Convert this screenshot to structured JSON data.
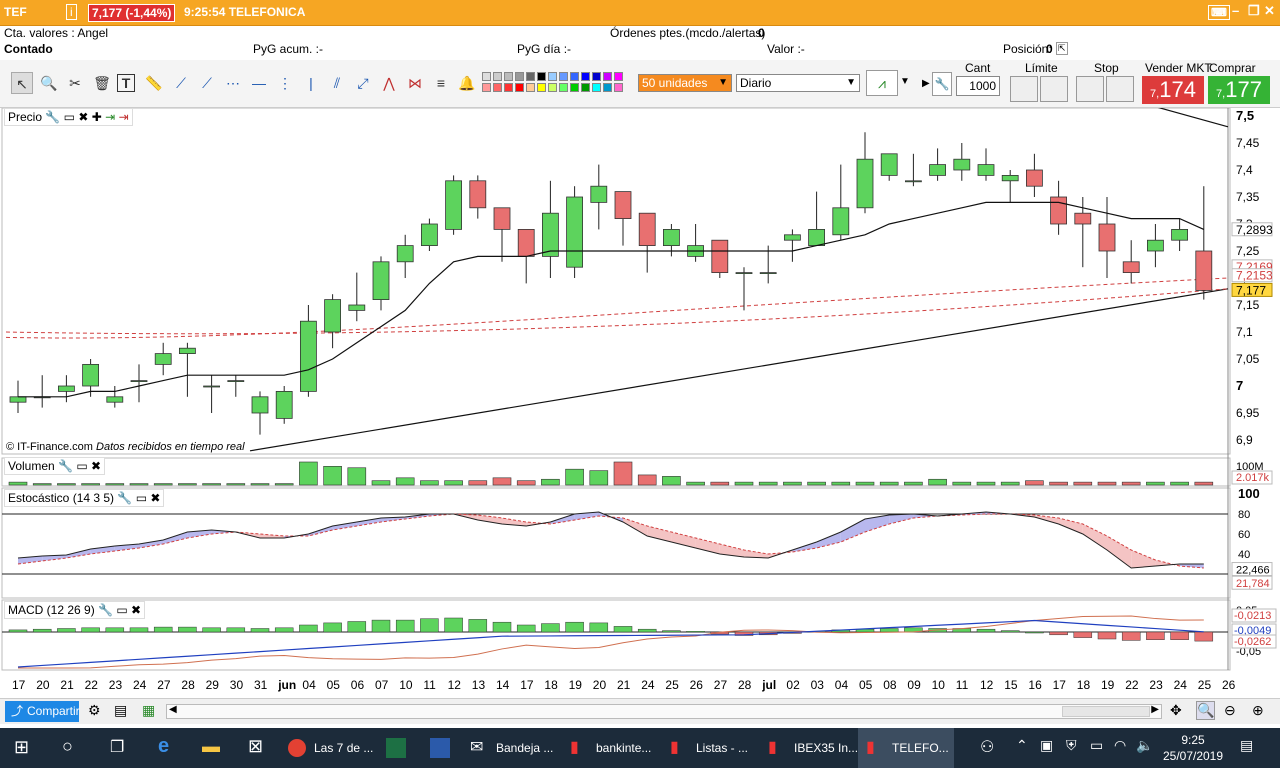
{
  "titlebar": {
    "symbol": "TEF",
    "price_change": "7,177 (-1,44%)",
    "time_name": "9:25:54 TELEFONICA"
  },
  "info": {
    "account": "Cta. valores : Angel",
    "pending_label": "Órdenes ptes.(mcdo./alertas)",
    "pending_value": "0",
    "mode": "Contado",
    "pyg_acum": "PyG acum. :-",
    "pyg_dia": "PyG día :-",
    "valor": "Valor :-",
    "posicion_label": "Posición:",
    "posicion_value": "0"
  },
  "toolbar": {
    "units": "50 unidades",
    "period": "Diario",
    "cant_label": "Cant",
    "qty": "1000",
    "limit_label": "Límite",
    "stop_label": "Stop",
    "sell_label": "Vender MKT",
    "sell_price": "7,174",
    "sell_prefix": "7,",
    "sell_main": "174",
    "buy_label": "Comprar MKT",
    "buy_prefix": "7,",
    "buy_main": "177"
  },
  "panels": {
    "price": "Precio",
    "volume": "Volumen",
    "stoch": "Estocástico (14 3 5)",
    "macd": "MACD (12 26 9)",
    "credit": "© IT-Finance.com",
    "credit2": "Datos recibidos en tiempo real"
  },
  "price_axis": [
    "7,5",
    "7,45",
    "7,4",
    "7,35",
    "7,3",
    "7,25",
    "7,2",
    "7,15",
    "7,1",
    "7,05",
    "7",
    "6,95",
    "6,9"
  ],
  "price_tags": [
    "7,2893",
    "7,2169",
    "7,2153",
    "7,177"
  ],
  "vol_axis": [
    "100M",
    "2.017k"
  ],
  "stoch_axis": [
    "100",
    "80",
    "60",
    "40"
  ],
  "stoch_tags": [
    "22,466",
    "21,784"
  ],
  "macd_axis": [
    "0,05",
    "-0,05"
  ],
  "macd_tags": [
    "-0,0213",
    "-0,0049",
    "-0,0262"
  ],
  "dates": [
    "17",
    "20",
    "21",
    "22",
    "23",
    "24",
    "27",
    "28",
    "29",
    "30",
    "31",
    "jun",
    "04",
    "05",
    "06",
    "07",
    "10",
    "11",
    "12",
    "13",
    "14",
    "17",
    "18",
    "19",
    "20",
    "21",
    "24",
    "25",
    "26",
    "27",
    "28",
    "jul",
    "02",
    "03",
    "04",
    "05",
    "08",
    "09",
    "10",
    "11",
    "12",
    "15",
    "16",
    "17",
    "18",
    "19",
    "22",
    "23",
    "24",
    "25",
    "26"
  ],
  "chart_data": {
    "type": "candlestick",
    "x": [
      "17",
      "20",
      "21",
      "22",
      "23",
      "24",
      "27",
      "28",
      "29",
      "30",
      "31",
      "jun",
      "04",
      "05",
      "06",
      "07",
      "10",
      "11",
      "12",
      "13",
      "14",
      "17",
      "18",
      "19",
      "20",
      "21",
      "24",
      "25",
      "26",
      "27",
      "28",
      "jul",
      "02",
      "03",
      "04",
      "05",
      "08",
      "09",
      "10",
      "11",
      "12",
      "15",
      "16",
      "17",
      "18",
      "19",
      "22",
      "23",
      "24",
      "25"
    ],
    "open": [
      6.97,
      6.98,
      6.99,
      7.0,
      6.97,
      7.01,
      7.04,
      7.06,
      7.0,
      7.01,
      6.95,
      6.94,
      6.99,
      7.1,
      7.14,
      7.16,
      7.23,
      7.26,
      7.29,
      7.38,
      7.33,
      7.29,
      7.24,
      7.22,
      7.34,
      7.36,
      7.32,
      7.26,
      7.24,
      7.27,
      7.21,
      7.21,
      7.27,
      7.26,
      7.28,
      7.33,
      7.39,
      7.38,
      7.39,
      7.4,
      7.39,
      7.38,
      7.4,
      7.35,
      7.32,
      7.3,
      7.23,
      7.25,
      7.27,
      7.25
    ],
    "close": [
      6.98,
      6.98,
      7.0,
      7.04,
      6.98,
      7.01,
      7.06,
      7.07,
      7.0,
      7.01,
      6.98,
      6.99,
      7.12,
      7.16,
      7.15,
      7.23,
      7.26,
      7.3,
      7.38,
      7.33,
      7.29,
      7.24,
      7.32,
      7.35,
      7.37,
      7.31,
      7.26,
      7.29,
      7.26,
      7.21,
      7.21,
      7.21,
      7.28,
      7.29,
      7.33,
      7.42,
      7.43,
      7.38,
      7.41,
      7.42,
      7.41,
      7.39,
      7.37,
      7.3,
      7.3,
      7.25,
      7.21,
      7.27,
      7.29,
      7.177
    ],
    "high": [
      7.01,
      7.02,
      7.02,
      7.05,
      7.0,
      7.04,
      7.08,
      7.08,
      7.02,
      7.02,
      6.99,
      7.0,
      7.15,
      7.17,
      7.21,
      7.24,
      7.28,
      7.31,
      7.39,
      7.39,
      7.32,
      7.26,
      7.38,
      7.37,
      7.41,
      7.36,
      7.32,
      7.3,
      7.3,
      7.27,
      7.22,
      7.26,
      7.29,
      7.36,
      7.41,
      7.47,
      7.43,
      7.43,
      7.44,
      7.45,
      7.44,
      7.4,
      7.43,
      7.38,
      7.35,
      7.35,
      7.27,
      7.3,
      7.31,
      7.37
    ],
    "low": [
      6.95,
      6.96,
      6.97,
      6.98,
      6.96,
      6.97,
      7.02,
      6.98,
      6.95,
      6.98,
      6.91,
      6.93,
      6.98,
      7.07,
      7.12,
      7.14,
      7.2,
      7.25,
      7.28,
      7.31,
      7.23,
      7.19,
      7.2,
      7.2,
      7.29,
      7.26,
      7.21,
      7.24,
      7.23,
      7.2,
      7.14,
      7.19,
      7.23,
      7.26,
      7.27,
      7.32,
      7.38,
      7.37,
      7.38,
      7.38,
      7.38,
      7.34,
      7.35,
      7.28,
      7.22,
      7.2,
      7.19,
      7.22,
      7.25,
      7.16
    ],
    "volume": [
      2,
      1,
      1,
      1,
      1,
      1,
      1,
      1,
      1,
      1,
      1,
      1,
      16,
      13,
      12,
      3,
      5,
      3,
      3,
      3,
      5,
      3,
      4,
      11,
      10,
      16,
      7,
      6,
      2,
      2,
      2,
      2,
      2,
      2,
      2,
      2,
      2,
      2,
      4,
      2,
      2,
      2,
      3,
      2,
      2,
      2,
      2,
      2,
      2,
      2
    ],
    "ma": [
      6.98,
      6.98,
      6.98,
      6.99,
      6.99,
      7.0,
      7.01,
      7.02,
      7.02,
      7.02,
      7.02,
      7.02,
      7.03,
      7.05,
      7.08,
      7.11,
      7.14,
      7.19,
      7.23,
      7.24,
      7.24,
      7.24,
      7.25,
      7.25,
      7.25,
      7.25,
      7.25,
      7.25,
      7.25,
      7.25,
      7.25,
      7.25,
      7.25,
      7.26,
      7.27,
      7.28,
      7.3,
      7.31,
      7.32,
      7.33,
      7.34,
      7.34,
      7.34,
      7.34,
      7.33,
      7.32,
      7.31,
      7.31,
      7.31,
      7.29
    ],
    "stoch_k": [
      36,
      38,
      39,
      45,
      48,
      50,
      54,
      62,
      64,
      62,
      56,
      56,
      60,
      68,
      72,
      76,
      77,
      80,
      80,
      74,
      70,
      68,
      72,
      80,
      82,
      72,
      58,
      52,
      46,
      40,
      37,
      36,
      44,
      52,
      62,
      75,
      79,
      80,
      78,
      80,
      82,
      80,
      77,
      70,
      60,
      44,
      26,
      28,
      30,
      30
    ],
    "stoch_d": [
      30,
      33,
      36,
      40,
      43,
      46,
      50,
      56,
      60,
      62,
      60,
      58,
      58,
      64,
      68,
      72,
      75,
      78,
      80,
      79,
      76,
      72,
      70,
      74,
      78,
      76,
      68,
      62,
      56,
      50,
      44,
      40,
      42,
      46,
      52,
      62,
      70,
      76,
      78,
      79,
      80,
      80,
      79,
      76,
      70,
      58,
      44,
      34,
      28,
      26
    ],
    "macd_hist": [
      0.003,
      0.004,
      0.005,
      0.006,
      0.006,
      0.006,
      0.007,
      0.007,
      0.006,
      0.006,
      0.005,
      0.006,
      0.01,
      0.013,
      0.015,
      0.017,
      0.017,
      0.019,
      0.02,
      0.018,
      0.014,
      0.01,
      0.012,
      0.014,
      0.013,
      0.008,
      0.004,
      0.002,
      0.001,
      -0.003,
      -0.005,
      -0.004,
      -0.002,
      0.001,
      0.003,
      0.004,
      0.005,
      0.006,
      0.005,
      0.005,
      0.004,
      0.002,
      0.0,
      -0.004,
      -0.008,
      -0.01,
      -0.012,
      -0.011,
      -0.011,
      -0.013
    ]
  }
}
